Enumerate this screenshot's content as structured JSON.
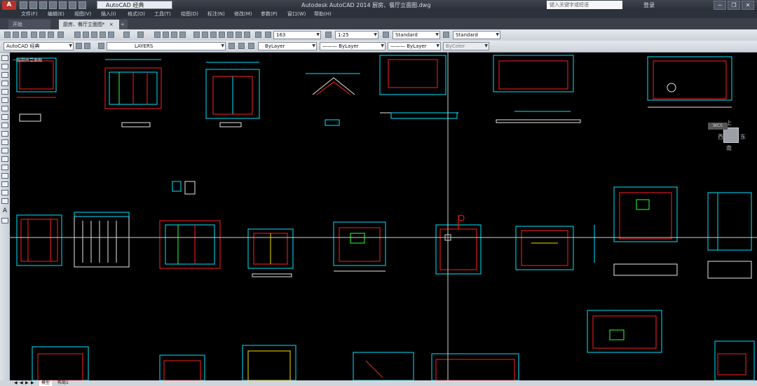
{
  "titlebar": {
    "app_menu": "A",
    "workspace": "AutoCAD 经典",
    "title": "Autodesk AutoCAD 2014    厨房、餐厅立面图.dwg",
    "search_placeholder": "键入关键字或短语",
    "login": "登录",
    "window_controls": [
      "─",
      "❐",
      "✕"
    ]
  },
  "menubar": {
    "items": [
      "文件(F)",
      "编辑(E)",
      "视图(V)",
      "插入(I)",
      "格式(O)",
      "工具(T)",
      "绘图(D)",
      "标注(N)",
      "修改(M)",
      "参数(P)",
      "窗口(W)",
      "帮助(H)"
    ]
  },
  "tabs": {
    "start": "开始",
    "drawing": "厨房、餐厅立面图*",
    "drawing_close": "×",
    "new": "+"
  },
  "toolbar1": {
    "textstyle_value": "163",
    "scale_value": "1:25",
    "dimstyle_value": "Standard",
    "tablestyle_value": "Standard"
  },
  "toolbar2": {
    "workspace_value": "AutoCAD 经典",
    "layer_value": "LAYERS",
    "color_value": "ByLayer",
    "linetype_value": "——— ByLayer",
    "lineweight_value": "——— ByLayer",
    "plotstyle_value": "ByColor"
  },
  "canvas": {
    "viewcube_top": "上",
    "viewcube_west": "西",
    "viewcube_east": "东",
    "viewcube_south": "南",
    "wcs_label": "WCS",
    "drawing_title_left": "一层厨房立面图",
    "crosshair_color": "#cfcfcf",
    "colors": {
      "cyan": "#00e5ff",
      "red": "#ff2020",
      "white": "#e6e6e6",
      "green": "#2cff3a",
      "yellow": "#f0e000",
      "magenta": "#ff3cff"
    }
  },
  "layouttabs": {
    "nav": [
      "◀",
      "◀",
      "▶",
      "▶"
    ],
    "model": "模型",
    "layout": "布局1"
  }
}
